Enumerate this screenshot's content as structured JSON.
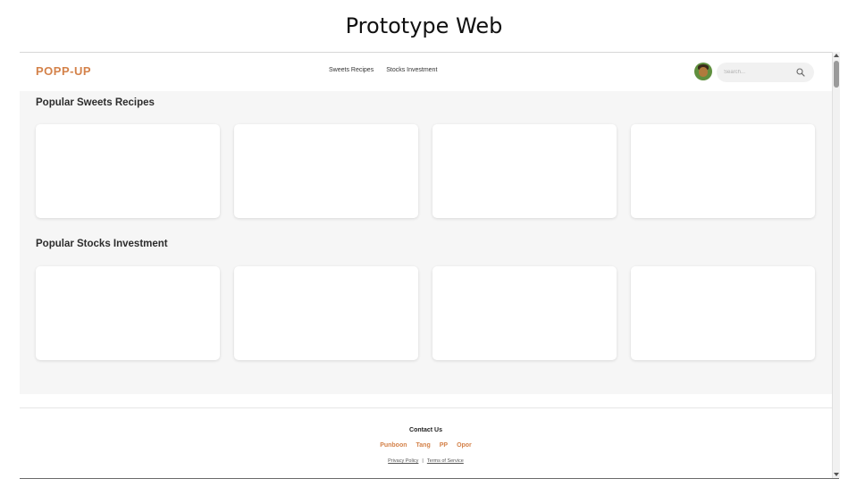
{
  "page_title": "Prototype Web",
  "navbar": {
    "logo": "POPP-UP",
    "links": [
      "Sweets Recipes",
      "Stocks Investment"
    ],
    "search_placeholder": "Search..."
  },
  "sections": [
    {
      "title": "Popular Sweets Recipes"
    },
    {
      "title": "Popular Stocks Investment"
    }
  ],
  "footer": {
    "contact_heading": "Contact Us",
    "names": [
      "Punboon",
      "Tang",
      "PP",
      "Opor"
    ],
    "privacy_label": "Privacy Policy",
    "separator": "|",
    "terms_label": "Terms of Service"
  },
  "colors": {
    "accent": "#d4824a",
    "background": "#f6f6f6"
  }
}
